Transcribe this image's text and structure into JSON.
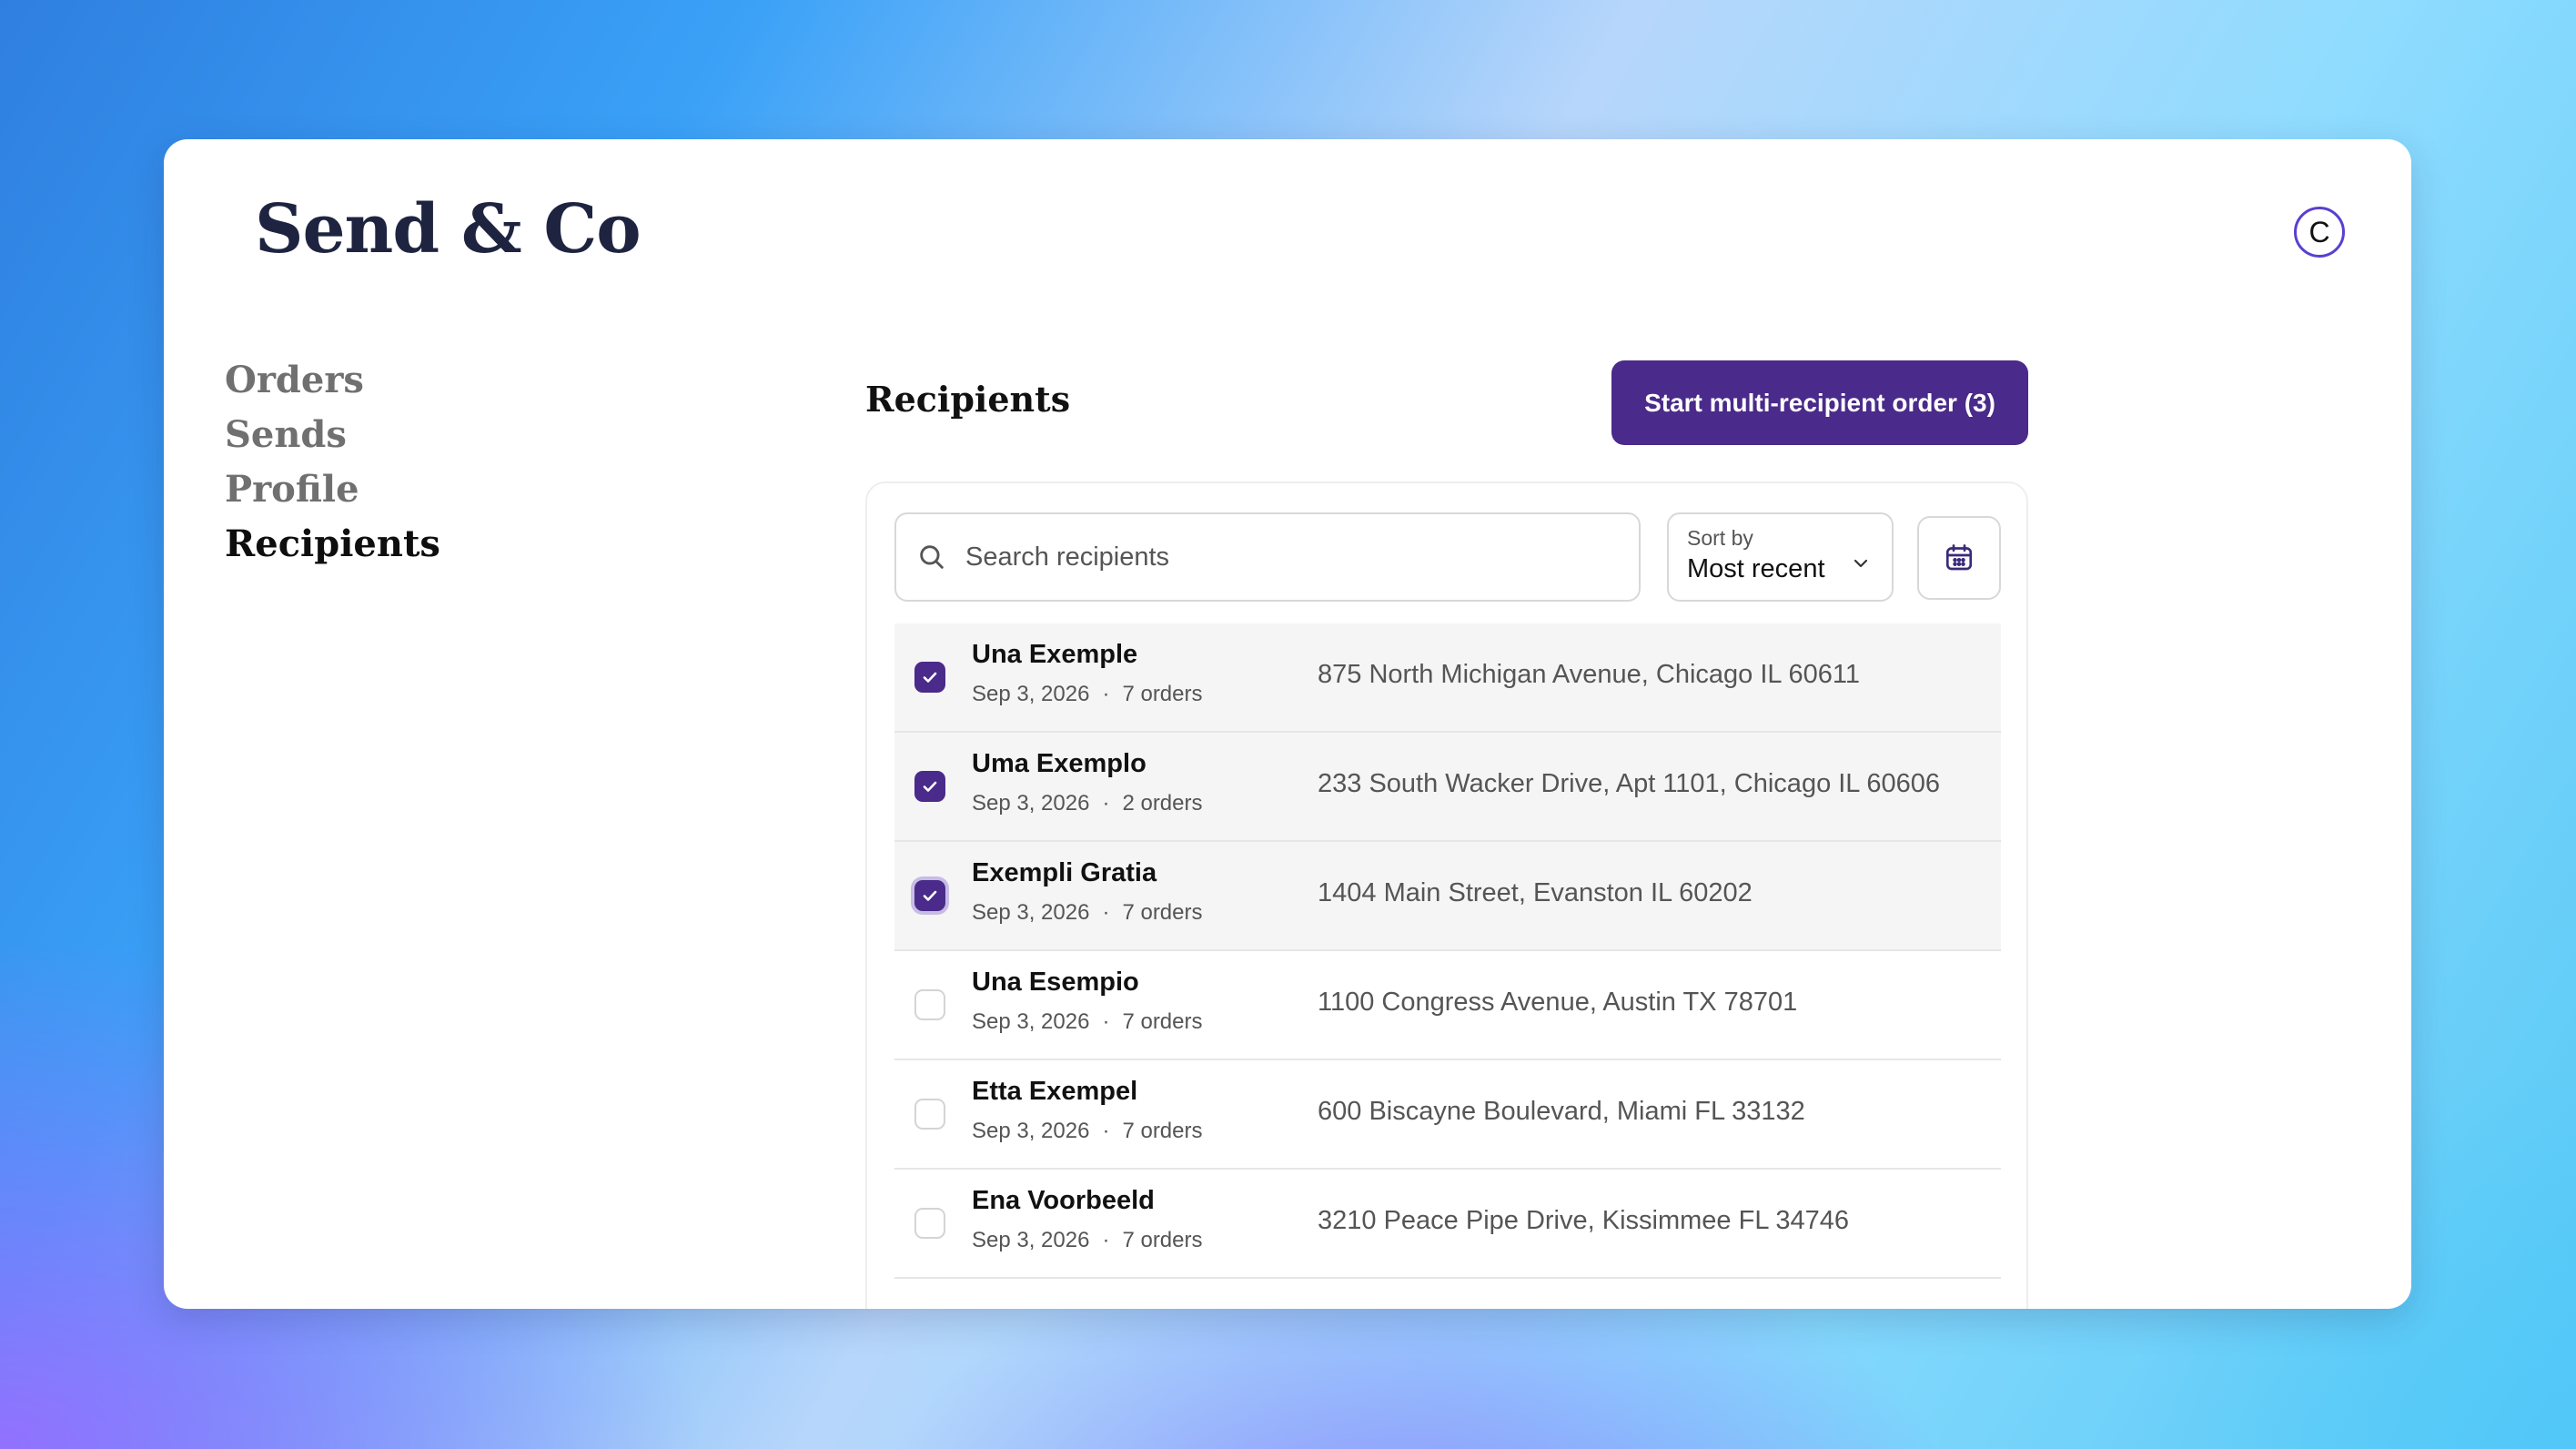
{
  "app": {
    "logo": "Send & Co",
    "avatar_initial": "C"
  },
  "nav": {
    "items": [
      {
        "label": "Orders",
        "active": false
      },
      {
        "label": "Sends",
        "active": false
      },
      {
        "label": "Profile",
        "active": false
      },
      {
        "label": "Recipients",
        "active": true
      }
    ]
  },
  "main": {
    "title": "Recipients",
    "primary_button": "Start multi-recipient order (3)",
    "search": {
      "placeholder": "Search recipients",
      "value": ""
    },
    "sort": {
      "label": "Sort by",
      "value": "Most recent"
    },
    "icons": {
      "search": "search-icon",
      "sort": "chevron-down-icon",
      "calendar": "calendar-icon",
      "check": "check-icon"
    }
  },
  "colors": {
    "accent": "#4a2a8a",
    "avatar_ring": "#5a3fd0"
  },
  "recipients": [
    {
      "name": "Una Exemple",
      "date": "Sep 3, 2026",
      "orders": "7 orders",
      "address": "875 North Michigan Avenue, Chicago IL 60611",
      "selected": true
    },
    {
      "name": "Uma Exemplo",
      "date": "Sep 3, 2026",
      "orders": "2 orders",
      "address": "233 South Wacker Drive, Apt 1101, Chicago IL 60606",
      "selected": true
    },
    {
      "name": "Exempli Gratia",
      "date": "Sep 3, 2026",
      "orders": "7 orders",
      "address": "1404 Main Street, Evanston IL 60202",
      "selected": true
    },
    {
      "name": "Una Esempio",
      "date": "Sep 3, 2026",
      "orders": "7 orders",
      "address": "1100 Congress Avenue, Austin TX 78701",
      "selected": false
    },
    {
      "name": "Etta Exempel",
      "date": "Sep 3, 2026",
      "orders": "7 orders",
      "address": "600 Biscayne Boulevard, Miami FL 33132",
      "selected": false
    },
    {
      "name": "Ena Voorbeeld",
      "date": "Sep 3, 2026",
      "orders": "7 orders",
      "address": "3210 Peace Pipe Drive, Kissimmee FL 34746",
      "selected": false
    }
  ]
}
